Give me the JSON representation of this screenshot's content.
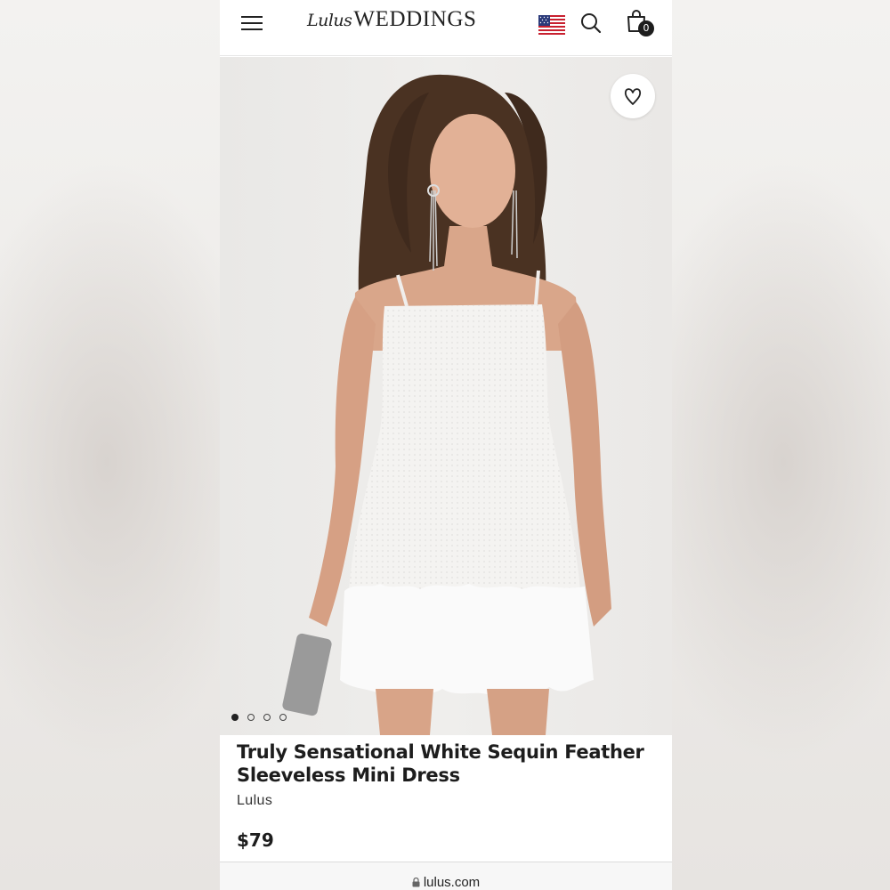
{
  "header": {
    "logo_script": "Lulus",
    "logo_main": "WEDDINGS",
    "cart_count": "0",
    "icons": [
      "menu-icon",
      "us-flag-icon",
      "search-icon",
      "shopping-bag-icon"
    ]
  },
  "product": {
    "title": "Truly Sensational White Sequin Feather Sleeveless Mini Dress",
    "brand": "Lulus",
    "price": "$79",
    "image_count": 4,
    "active_image": 1,
    "icons": [
      "heart-icon"
    ]
  },
  "browser": {
    "url": "lulus.com"
  },
  "colors": {
    "text": "#1d1d1d",
    "background": "#ffffff",
    "photo_background": "#ecebe9"
  }
}
